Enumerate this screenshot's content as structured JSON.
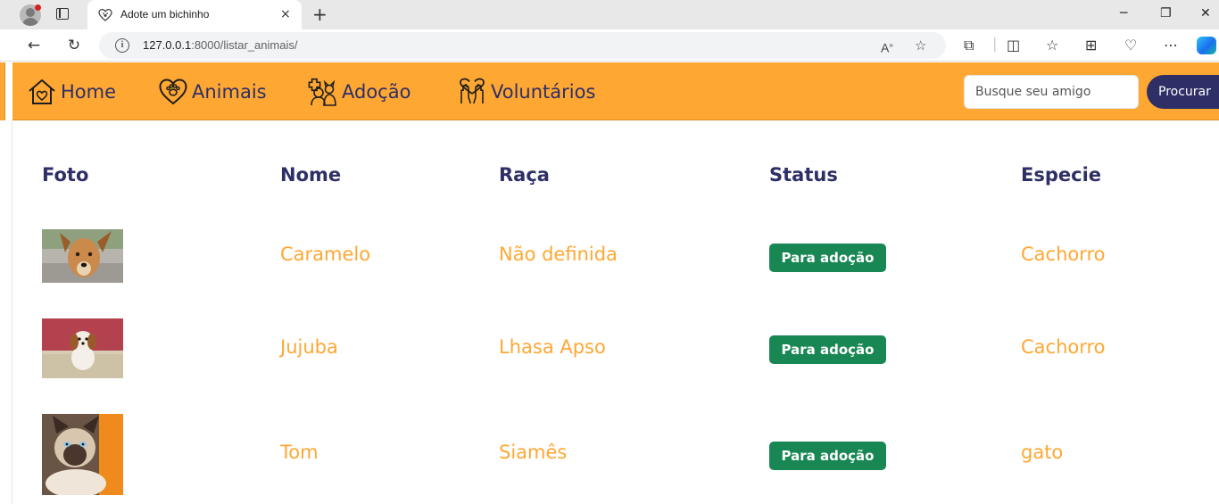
{
  "browser": {
    "tab_title": "Adote um bichinho",
    "tab_close": "×",
    "new_tab": "+",
    "url_host": "127.0.0.1",
    "url_rest": ":8000/listar_animais/",
    "window_min": "─",
    "window_max": "❐",
    "window_close": "✕"
  },
  "nav": {
    "items": [
      {
        "label": "Home",
        "icon": "house-icon"
      },
      {
        "label": "Animais",
        "icon": "heart-paw-icon"
      },
      {
        "label": "Adoção",
        "icon": "pets-adoption-icon"
      },
      {
        "label": "Voluntários",
        "icon": "helping-hands-icon"
      }
    ],
    "search_placeholder": "Busque seu amigo",
    "search_button": "Procurar"
  },
  "colors": {
    "nav_bg": "#ffa733",
    "nav_text": "#2d2f66",
    "cell_text": "#ffa733",
    "badge_bg": "#198754"
  },
  "table": {
    "headers": [
      "Foto",
      "Nome",
      "Raça",
      "Status",
      "Especie"
    ],
    "rows": [
      {
        "photo": "dog-photo",
        "nome": "Caramelo",
        "raca": "Não definida",
        "status": "Para adoção",
        "especie": "Cachorro"
      },
      {
        "photo": "puppy-photo",
        "nome": "Jujuba",
        "raca": "Lhasa Apso",
        "status": "Para adoção",
        "especie": "Cachorro"
      },
      {
        "photo": "cat-photo",
        "nome": "Tom",
        "raca": "Siamês",
        "status": "Para adoção",
        "especie": "gato"
      }
    ]
  }
}
